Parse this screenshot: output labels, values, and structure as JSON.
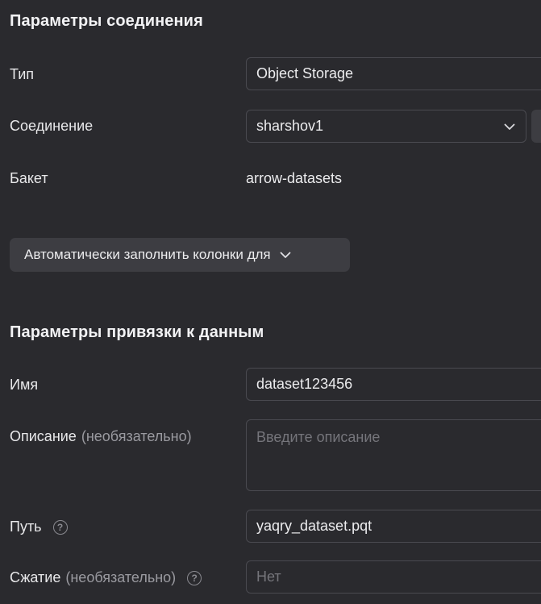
{
  "connection_section": {
    "title": "Параметры соединения",
    "type_label": "Тип",
    "type_value": "Object Storage",
    "connection_label": "Соединение",
    "connection_value": "sharshov1",
    "bucket_label": "Бакет",
    "bucket_value": "arrow-datasets"
  },
  "autofill_button": {
    "label": "Автоматически заполнить колонки для"
  },
  "binding_section": {
    "title": "Параметры привязки к данным",
    "name_label": "Имя",
    "name_value": "dataset123456",
    "description_label": "Описание",
    "description_optional": "(необязательно)",
    "description_placeholder": "Введите описание",
    "path_label": "Путь",
    "path_value": "yaqry_dataset.pqt",
    "compression_label": "Сжатие",
    "compression_optional": "(необязательно)",
    "compression_placeholder": "Нет"
  },
  "icons": {
    "chevron": "chevron-down-icon",
    "help": "help-circle-icon"
  }
}
